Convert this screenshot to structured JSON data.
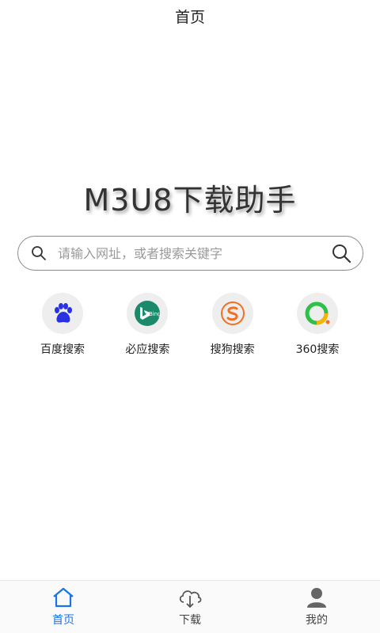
{
  "header": {
    "title": "首页"
  },
  "app": {
    "title": "M3U8下载助手"
  },
  "search": {
    "placeholder": "请输入网址，或者搜索关键字",
    "value": ""
  },
  "engines": [
    {
      "label": "百度搜索",
      "icon": "baidu-paw-icon",
      "color": "#2932e1"
    },
    {
      "label": "必应搜索",
      "icon": "bing-icon",
      "color": "#1b8a6b",
      "badge": "Bing"
    },
    {
      "label": "搜狗搜索",
      "icon": "sogou-icon",
      "color": "#f36f21"
    },
    {
      "label": "360搜索",
      "icon": "360-icon",
      "color": "#2fbf4a"
    }
  ],
  "tabs": [
    {
      "label": "首页",
      "icon": "home-icon",
      "active": true
    },
    {
      "label": "下载",
      "icon": "cloud-download-icon",
      "active": false
    },
    {
      "label": "我的",
      "icon": "user-icon",
      "active": false
    }
  ],
  "colors": {
    "accent": "#1a73e8",
    "text": "#222222",
    "muted": "#9a9a9a"
  }
}
